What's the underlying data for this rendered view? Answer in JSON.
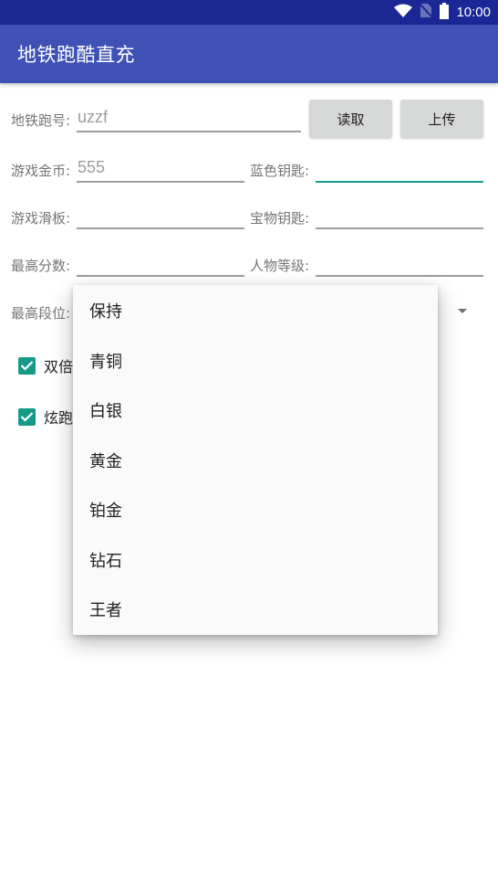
{
  "status_bar": {
    "time": "10:00",
    "icons": [
      "wifi-icon",
      "no-sim-icon",
      "battery-icon"
    ]
  },
  "app_bar": {
    "title": "地铁跑酷直充"
  },
  "form": {
    "account": {
      "label": "地铁跑号:",
      "value": "uzzf"
    },
    "read_button": "读取",
    "upload_button": "上传",
    "coins": {
      "label": "游戏金币:",
      "value": "555"
    },
    "blue_keys": {
      "label": "蓝色钥匙:",
      "value": ""
    },
    "skateboards": {
      "label": "游戏滑板:",
      "value": ""
    },
    "treasure_keys": {
      "label": "宝物钥匙:",
      "value": ""
    },
    "high_score": {
      "label": "最高分数:",
      "value": ""
    },
    "character_level": {
      "label": "人物等级:",
      "value": ""
    },
    "highest_rank": {
      "label": "最高段位:"
    },
    "checkboxes": [
      {
        "label": "双倍",
        "checked": true
      },
      {
        "label": "炫跑",
        "checked": true
      }
    ]
  },
  "rank_dropdown": {
    "options": [
      "保持",
      "青铜",
      "白银",
      "黄金",
      "铂金",
      "钻石",
      "王者"
    ]
  },
  "colors": {
    "status_bar": "#1a2795",
    "app_bar": "#3f51b5",
    "accent": "#159a87",
    "button": "#d6d7d7"
  }
}
